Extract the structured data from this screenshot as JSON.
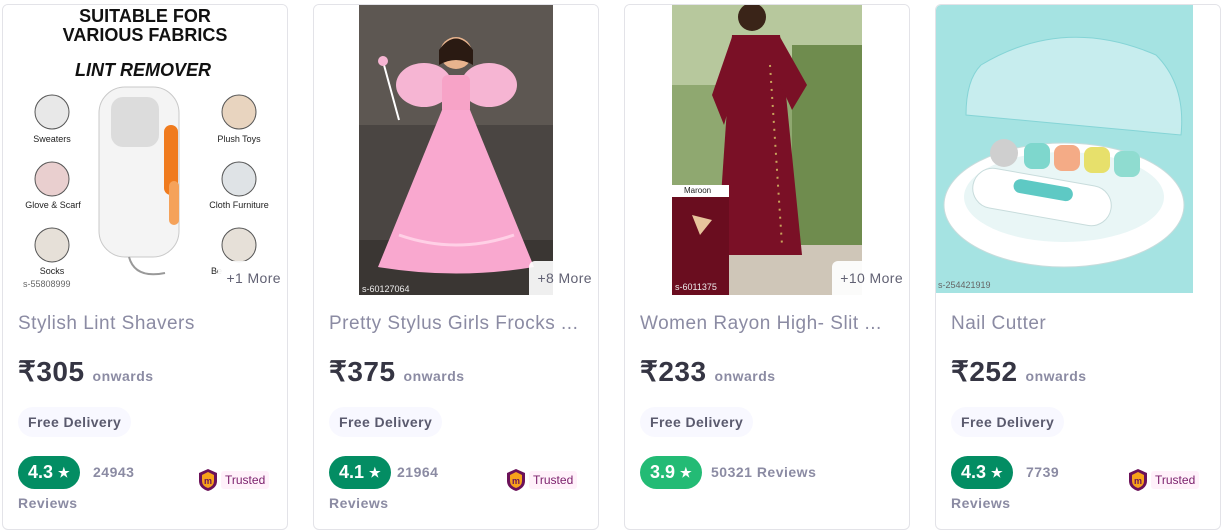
{
  "products": [
    {
      "title": "Stylish Lint Shavers",
      "price": "₹305",
      "onwards": "onwards",
      "delivery": "Free Delivery",
      "rating": "4.3",
      "rating_color": "#038d63",
      "reviews_count": "24943",
      "reviews_label": "Reviews",
      "trusted": "Trusted",
      "more": "+1 More",
      "sku": "s-55808999",
      "image_text": {
        "headline1": "SUITABLE FOR",
        "headline2": "VARIOUS FABRICS",
        "subhead": "LINT REMOVER",
        "labels": [
          "Sweaters",
          "Glove & Scarf",
          "Socks",
          "Plush Toys",
          "Cloth Furniture",
          "Be"
        ]
      }
    },
    {
      "title": "Pretty Stylus Girls Frocks ...",
      "price": "₹375",
      "onwards": "onwards",
      "delivery": "Free Delivery",
      "rating": "4.1",
      "rating_color": "#038d63",
      "reviews_count": "21964",
      "reviews_label": "Reviews",
      "trusted": "Trusted",
      "more": "+8 More",
      "sku": "s-60127064"
    },
    {
      "title": "Women Rayon High- Slit ...",
      "price": "₹233",
      "onwards": "onwards",
      "delivery": "Free Delivery",
      "rating": "3.9",
      "rating_color": "#23bb75",
      "reviews_count": "50321 Reviews",
      "more": "+10 More",
      "sku": "s-6011375",
      "image_text": {
        "swatch_label": "Maroon"
      }
    },
    {
      "title": "Nail Cutter",
      "price": "₹252",
      "onwards": "onwards",
      "delivery": "Free Delivery",
      "rating": "4.3",
      "rating_color": "#038d63",
      "reviews_count": "7739",
      "reviews_label": "Reviews",
      "trusted": "Trusted",
      "sku": "s-254421919"
    }
  ],
  "icons": {
    "star": "star-icon",
    "trusted": "trusted-shield-icon"
  }
}
